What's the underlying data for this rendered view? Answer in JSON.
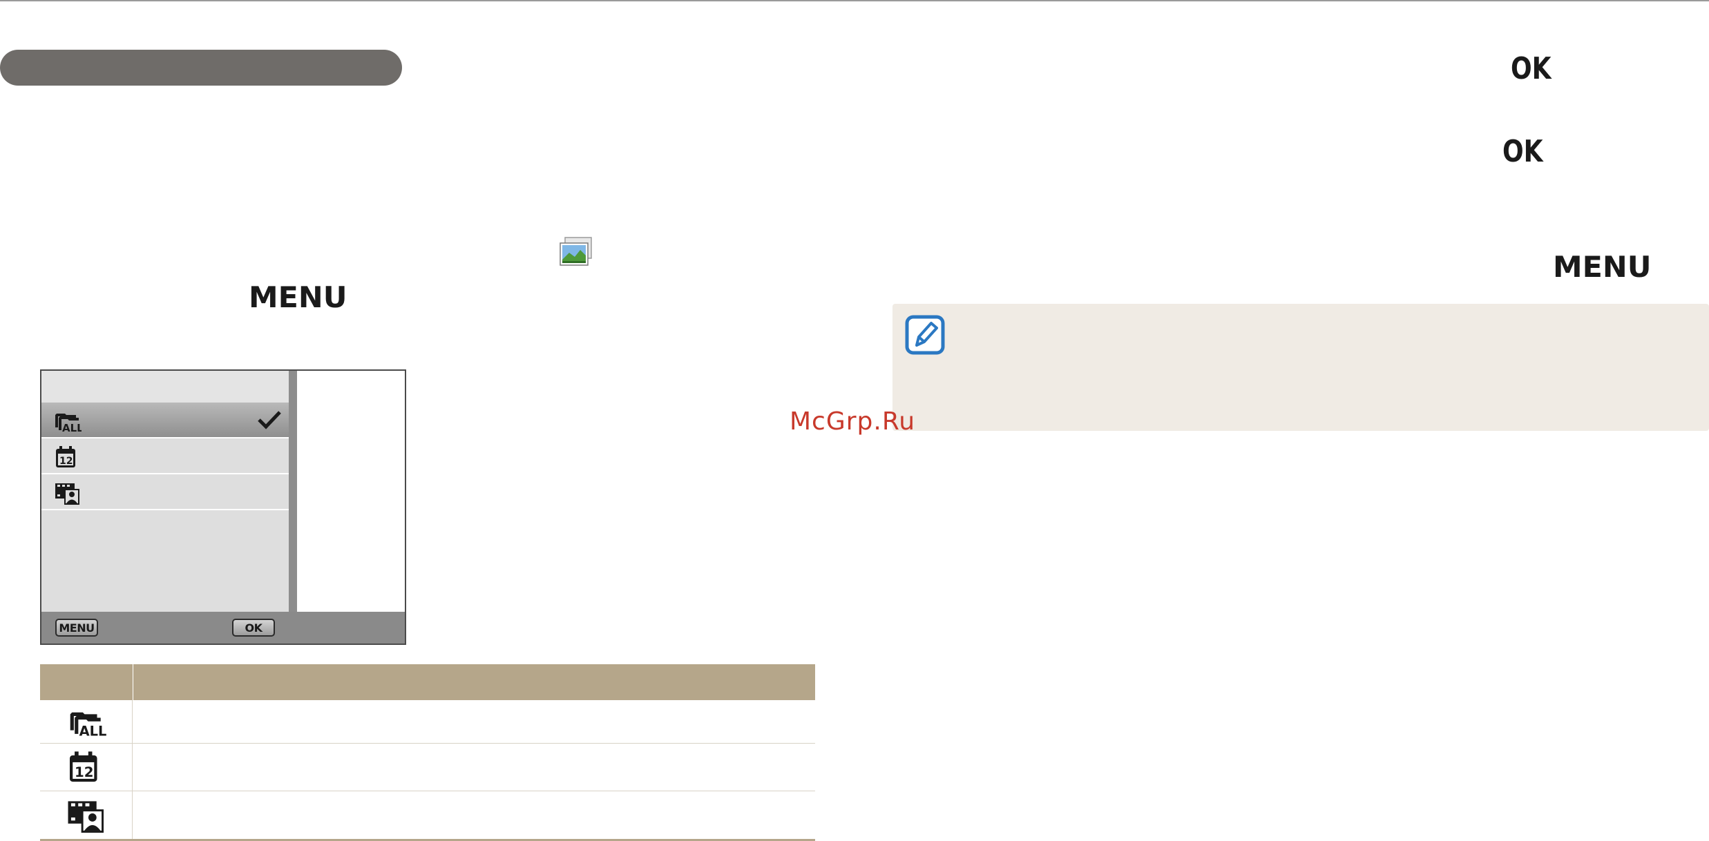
{
  "steps": {
    "menu_button": "MENU",
    "ok_button_1": "OK",
    "ok_button_2": "OK",
    "menu_button_2": "MENU"
  },
  "screen": {
    "rows": [
      {
        "icon": "all-files-icon",
        "selected": true
      },
      {
        "icon": "date-calendar-icon",
        "selected": false
      },
      {
        "icon": "face-filmstrip-icon",
        "selected": false
      }
    ],
    "softkeys": {
      "menu": "MENU",
      "ok": "OK"
    }
  },
  "table": {
    "rows": [
      {
        "icon": "all-files-icon"
      },
      {
        "icon": "date-calendar-icon"
      },
      {
        "icon": "face-filmstrip-icon"
      }
    ]
  },
  "note": {
    "icon": "note-pencil-icon"
  },
  "watermark": "McGrp.Ru",
  "colors": {
    "header_bar": "#6f6c69",
    "table_header": "#b5a68a",
    "note_background": "#f0ebe4",
    "note_icon": "#2b78c2",
    "watermark": "#c8392b"
  }
}
